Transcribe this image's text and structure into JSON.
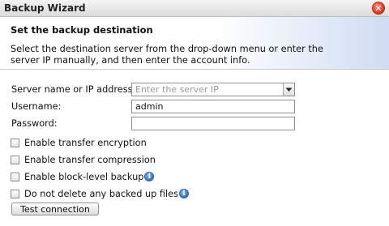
{
  "window": {
    "title": "Backup Wizard",
    "close_icon": "close-icon"
  },
  "header": {
    "heading": "Set the backup destination",
    "description": "Select the destination server from the drop-down menu or enter the server IP manually, and then enter the account info."
  },
  "form": {
    "server_label": "Server name or IP address:",
    "server_placeholder": "Enter the server IP",
    "server_value": "",
    "username_label": "Username:",
    "username_value": "admin",
    "password_label": "Password:",
    "password_value": ""
  },
  "options": [
    {
      "label": "Enable transfer encryption",
      "checked": false,
      "info": false
    },
    {
      "label": "Enable transfer compression",
      "checked": false,
      "info": false
    },
    {
      "label": "Enable block-level backup",
      "checked": false,
      "info": true
    },
    {
      "label": "Do not delete any backed up files",
      "checked": false,
      "info": true
    }
  ],
  "buttons": {
    "test_connection": "Test connection"
  },
  "colors": {
    "close": "#d6341f",
    "info": "#2f6ec4",
    "header_gradient_end": "#cfdcf2"
  }
}
